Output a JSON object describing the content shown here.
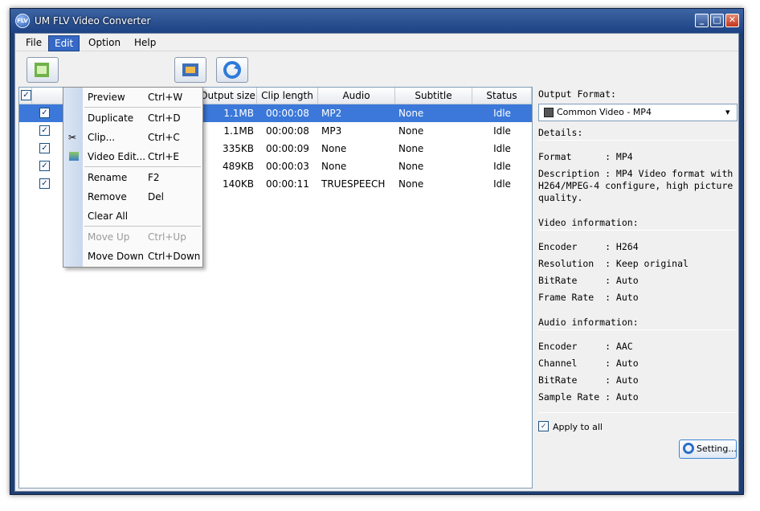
{
  "window": {
    "title": "UM FLV Video Converter",
    "icon_text": "FLV"
  },
  "menubar": [
    "File",
    "Edit",
    "Option",
    "Help"
  ],
  "toolbar": {
    "buttons": [
      "add-file-icon",
      "edit-menu-hidden-icon",
      "film-icon",
      "convert-icon"
    ]
  },
  "table": {
    "columns": [
      "Output size",
      "Clip length",
      "Audio",
      "Subtitle",
      "Status"
    ],
    "rows": [
      {
        "size": "1.1MB",
        "length": "00:00:08",
        "audio": "MP2",
        "subtitle": "None",
        "status": "Idle",
        "selected": true
      },
      {
        "size": "1.1MB",
        "length": "00:00:08",
        "audio": "MP3",
        "subtitle": "None",
        "status": "Idle",
        "selected": false
      },
      {
        "size": "335KB",
        "length": "00:00:09",
        "audio": "None",
        "subtitle": "None",
        "status": "Idle",
        "selected": false
      },
      {
        "size": "489KB",
        "length": "00:00:03",
        "audio": "None",
        "subtitle": "None",
        "status": "Idle",
        "selected": false
      },
      {
        "size": "140KB",
        "length": "00:00:11",
        "audio": "TRUESPEECH",
        "subtitle": "None",
        "status": "Idle",
        "selected": false
      }
    ]
  },
  "edit_menu": {
    "items": [
      {
        "label": "Preview",
        "shortcut": "Ctrl+W"
      },
      {
        "label": "Duplicate",
        "shortcut": "Ctrl+D"
      },
      {
        "label": "Clip...",
        "shortcut": "Ctrl+C"
      },
      {
        "label": "Video Edit...",
        "shortcut": "Ctrl+E"
      },
      {
        "label": "Rename",
        "shortcut": "F2"
      },
      {
        "label": "Remove",
        "shortcut": "Del"
      },
      {
        "label": "Clear All",
        "shortcut": ""
      },
      {
        "label": "Move Up",
        "shortcut": "Ctrl+Up"
      },
      {
        "label": "Move Down",
        "shortcut": "Ctrl+Down"
      }
    ]
  },
  "right_panel": {
    "output_format_label": "Output Format:",
    "format_value": "Common Video - MP4",
    "details_label": "Details:",
    "format_line": "Format      : MP4",
    "description_lines": [
      "Description : MP4 Video format with",
      "H264/MPEG-4 configure, high picture",
      "quality."
    ],
    "video_info_label": "Video information:",
    "video_lines": [
      "Encoder     : H264",
      "Resolution  : Keep original",
      "BitRate     : Auto",
      "Frame Rate  : Auto"
    ],
    "audio_info_label": "Audio information:",
    "audio_lines": [
      "Encoder     : AAC",
      "Channel     : Auto",
      "BitRate     : Auto",
      "Sample Rate : Auto"
    ],
    "apply_to_all_label": "Apply to all",
    "apply_to_all_checked": true,
    "setting_button_label": "Setting..."
  }
}
